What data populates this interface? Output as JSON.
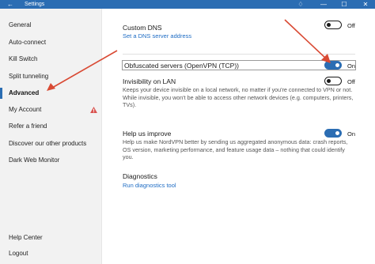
{
  "window": {
    "title": "Settings",
    "back_glyph": "←",
    "notification_glyph": "♢",
    "minimize_glyph": "—",
    "maximize_glyph": "☐",
    "close_glyph": "✕",
    "accent_color": "#2b6db3"
  },
  "sidebar": {
    "items": [
      {
        "label": "General"
      },
      {
        "label": "Auto-connect"
      },
      {
        "label": "Kill Switch"
      },
      {
        "label": "Split tunneling"
      },
      {
        "label": "Advanced",
        "active": true
      },
      {
        "label": "My Account",
        "warning": true
      },
      {
        "label": "Refer a friend"
      },
      {
        "label": "Discover our other products"
      },
      {
        "label": "Dark Web Monitor"
      }
    ],
    "bottom_items": [
      {
        "label": "Help Center"
      },
      {
        "label": "Logout"
      }
    ],
    "warning_color": "#d9534f"
  },
  "settings": {
    "custom_dns": {
      "title": "Custom DNS",
      "link": "Set a DNS server address",
      "state_label": "Off",
      "enabled": false
    },
    "obfuscated": {
      "title": "Obfuscated servers (OpenVPN (TCP))",
      "state_label": "On",
      "enabled": true
    },
    "invisibility": {
      "title": "Invisibility on LAN",
      "description": "Keeps your device invisible on a local network, no matter if you're connected to VPN or not. While invisible, you won't be able to access other network devices (e.g. computers, printers, TVs).",
      "state_label": "Off",
      "enabled": false
    },
    "help_improve": {
      "title": "Help us improve",
      "description": "Help us make NordVPN better by sending us aggregated anonymous data: crash reports, OS version, marketing performance, and feature usage data – nothing that could identify you.",
      "state_label": "On",
      "enabled": true
    },
    "diagnostics": {
      "title": "Diagnostics",
      "link": "Run diagnostics tool"
    }
  },
  "annotations": {
    "arrow_color": "#d94a34"
  }
}
